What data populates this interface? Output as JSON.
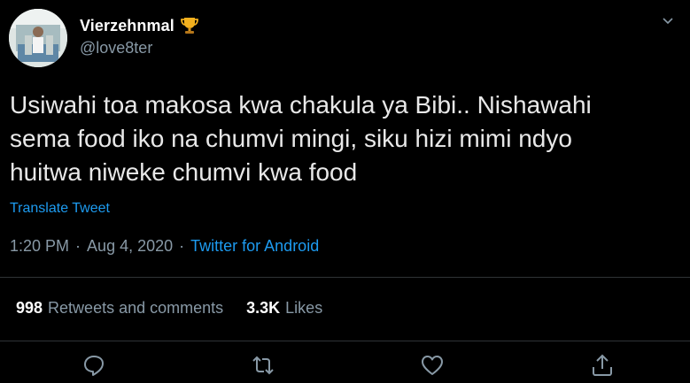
{
  "user": {
    "display_name": "Vierzehnmal",
    "handle": "@love8ter",
    "badge_icon": "trophy-icon"
  },
  "tweet": {
    "text": "Usiwahi toa makosa kwa chakula ya Bibi.. Nishawahi\nsema food iko na chumvi mingi, siku hizi mimi ndyo\nhuitwa niweke chumvi kwa food",
    "translate_label": "Translate Tweet",
    "time": "1:20 PM",
    "date": "Aug 4, 2020",
    "separator": "·",
    "source": "Twitter for Android"
  },
  "stats": {
    "retweets_count": "998",
    "retweets_label": "Retweets and comments",
    "likes_count": "3.3K",
    "likes_label": "Likes"
  },
  "actions": [
    "reply-icon",
    "retweet-icon",
    "like-icon",
    "share-icon"
  ],
  "colors": {
    "background": "#000000",
    "accent": "#1d9bf0",
    "muted": "#8899a6",
    "divider": "#2f3336"
  }
}
